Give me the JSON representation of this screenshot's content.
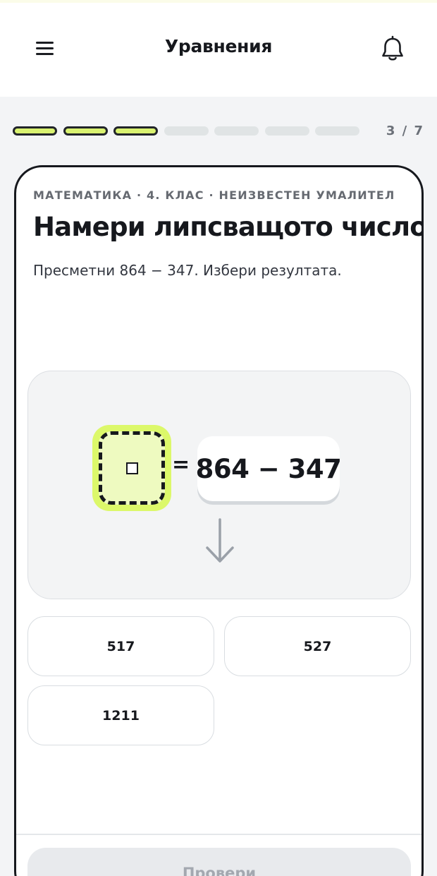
{
  "header": {
    "title": "Уравнения",
    "menu_icon": "menu-icon",
    "bell_icon": "bell-icon"
  },
  "progress": {
    "completed": 3,
    "total": 7,
    "label": "3 / 7"
  },
  "task": {
    "breadcrumb": "МАТЕМАТИКА · 4. КЛАС · НЕИЗВЕСТЕН УМАЛИТЕЛ",
    "title": "Намери липсващото число",
    "description": "Пресметни 864 − 347. Избери резултата."
  },
  "equation": {
    "equals": "=",
    "expression": "864 − 347",
    "blank_icon": "blank-square-icon",
    "arrow_icon": "arrow-down-icon"
  },
  "answers": [
    {
      "label": "517"
    },
    {
      "label": "527"
    },
    {
      "label": "1211"
    }
  ],
  "footer": {
    "check_label": "Провери"
  },
  "colors": {
    "accent": "#d9f270",
    "ink": "#16181d",
    "panel": "#f3f4f5"
  }
}
